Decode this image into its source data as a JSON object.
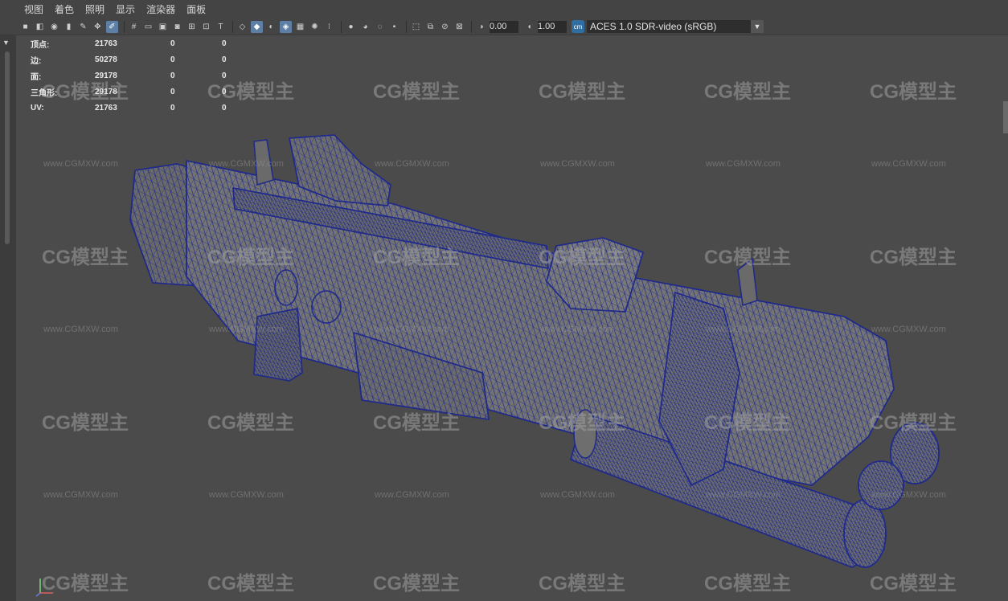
{
  "menu": [
    "视图",
    "着色",
    "照明",
    "显示",
    "渲染器",
    "面板"
  ],
  "toolbar": {
    "exposure_value": "0.00",
    "gamma_value": "1.00",
    "colorspace_label": "ACES 1.0 SDR-video (sRGB)",
    "colorspace_icon_text": "cm"
  },
  "hud": [
    {
      "label": "顶点:",
      "v1": "21763",
      "v2": "0",
      "v3": "0"
    },
    {
      "label": "边:",
      "v1": "50278",
      "v2": "0",
      "v3": "0"
    },
    {
      "label": "面:",
      "v1": "29178",
      "v2": "0",
      "v3": "0"
    },
    {
      "label": "三角形:",
      "v1": "29178",
      "v2": "0",
      "v3": "0"
    },
    {
      "label": "UV:",
      "v1": "21763",
      "v2": "0",
      "v3": "0"
    }
  ],
  "watermark": {
    "logo_text": "CG模型主",
    "url_text": "www.CGMXW.com"
  },
  "colors": {
    "background": "#4b4b4b",
    "mesh_fill": "#6e6e6e",
    "wire": "#1f2a8a",
    "active_tool": "#5d7fa6"
  }
}
